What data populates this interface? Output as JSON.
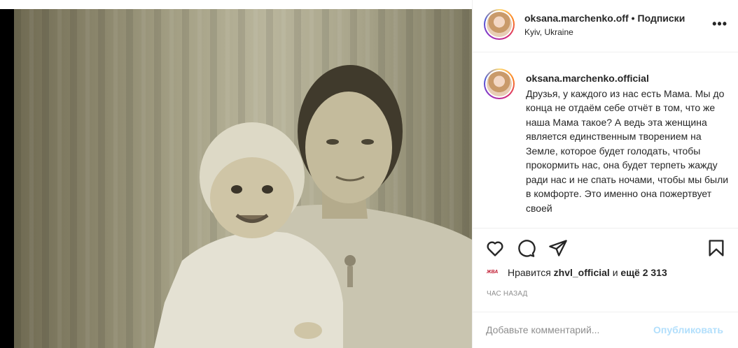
{
  "header": {
    "username": "oksana.marchenko.off",
    "separator": "•",
    "follow_label": "Подписки",
    "location": "Kyiv, Ukraine",
    "more_label": "•••"
  },
  "caption": {
    "username": "oksana.marchenko.official",
    "text": "Друзья, у каждого из нас есть Мама. Мы до конца не отдаём себе отчёт в том, что же наша Мама такое? А ведь эта женщина является единственным творением на Земле, которое будет голодать, чтобы прокормить нас, она будет терпеть жажду ради нас и не спать ночами, чтобы мы были в комфорте. Это именно она пожертвует своей"
  },
  "actions": {
    "like_icon": "heart-icon",
    "comment_icon": "comment-icon",
    "share_icon": "send-icon",
    "save_icon": "bookmark-icon"
  },
  "likes": {
    "avatar_text": "ЖВА",
    "prefix": "Нравится",
    "user": "zhvl_official",
    "conjunction": "и",
    "others": "ещё 2 313"
  },
  "time_label": "ЧАС НАЗАД",
  "comment": {
    "placeholder": "Добавьте комментарий...",
    "publish_label": "Опубликовать"
  },
  "colors": {
    "accent_disabled": "#b2dffc",
    "muted": "#8e8e8e"
  }
}
